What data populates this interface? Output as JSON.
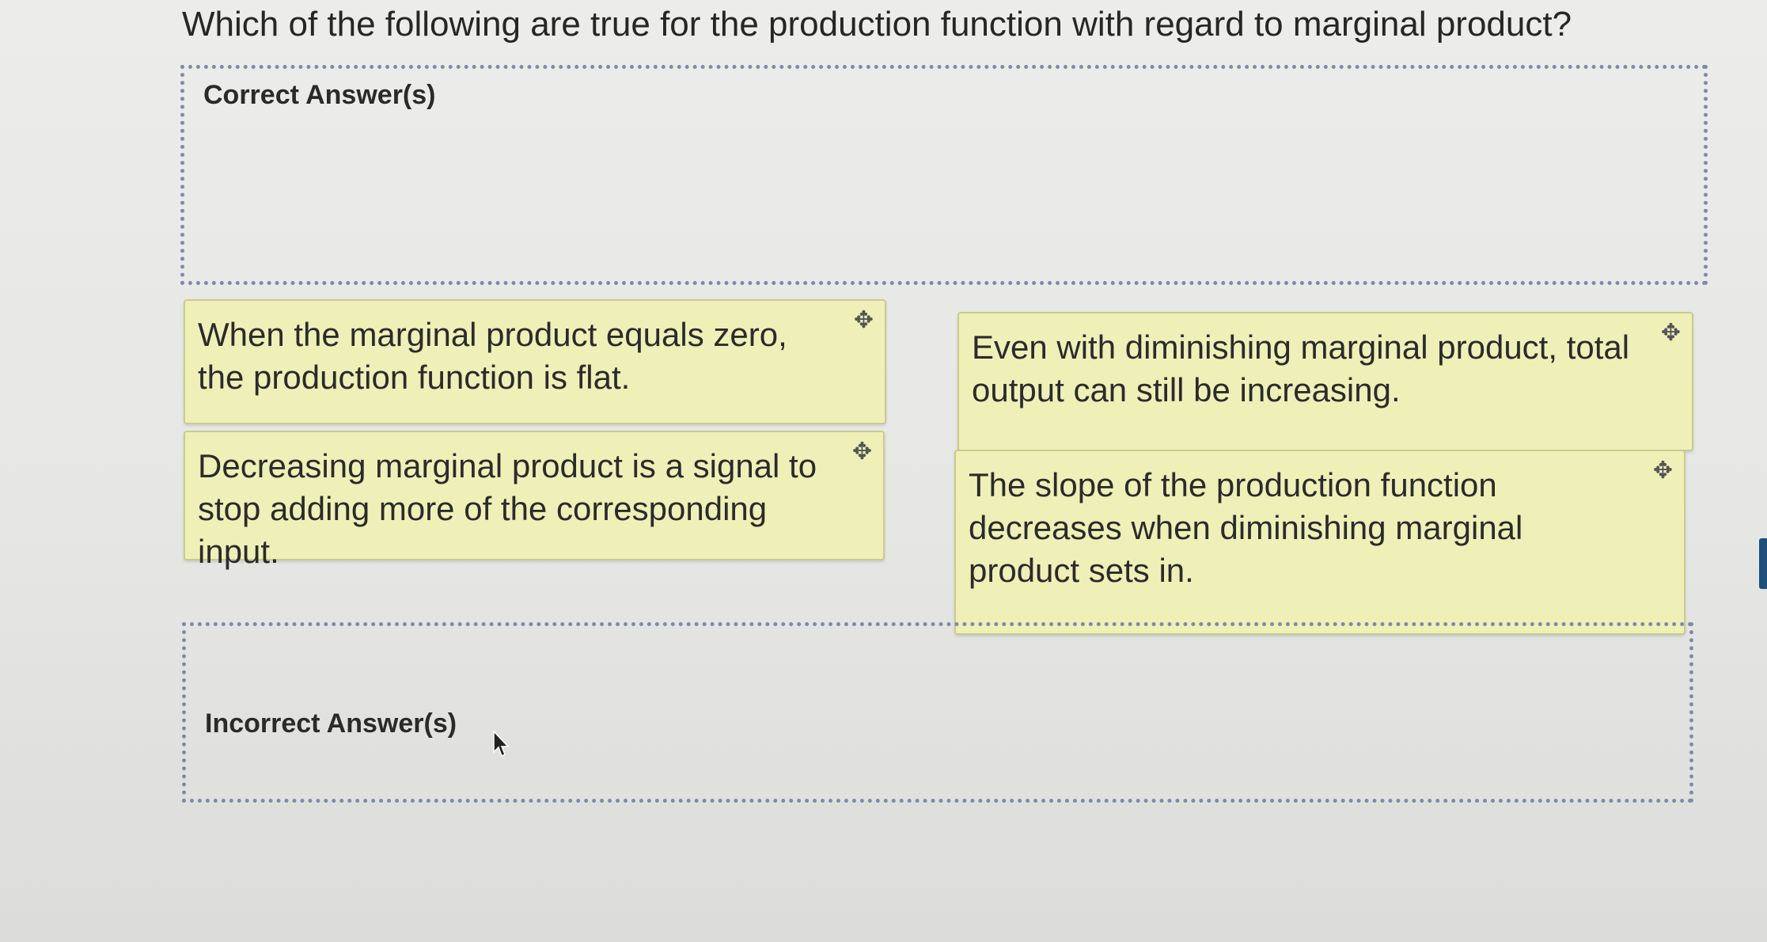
{
  "question": {
    "text": "Which of the following are true for the production function with regard to marginal product?"
  },
  "zones": {
    "correct_label": "Correct Answer(s)",
    "incorrect_label": "Incorrect Answer(s)"
  },
  "cards": [
    {
      "text": "When the marginal product equals zero, the production function is flat.",
      "icon": "move-icon"
    },
    {
      "text": "Even with diminishing marginal product, total output can still be increasing.",
      "icon": "move-icon"
    },
    {
      "text": "Decreasing marginal product is a signal to stop adding more of the corresponding input.",
      "icon": "move-icon"
    },
    {
      "text": "The slope of the production function decreases when diminishing marginal product sets in.",
      "icon": "move-icon"
    }
  ],
  "colors": {
    "card_background": "#eef0b8",
    "dropzone_border": "#7f8aa8",
    "edge_marker": "#1f4f7a"
  }
}
